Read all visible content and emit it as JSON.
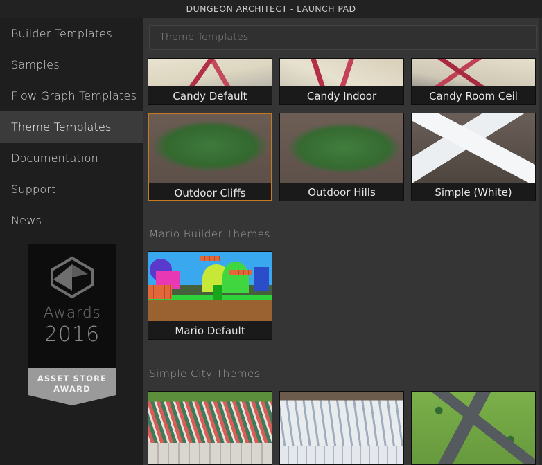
{
  "window": {
    "title": "DUNGEON ARCHITECT - LAUNCH PAD"
  },
  "sidebar": {
    "items": [
      {
        "label": "Builder Templates",
        "selected": false
      },
      {
        "label": "Samples",
        "selected": false
      },
      {
        "label": "Flow Graph Templates",
        "selected": false
      },
      {
        "label": "Theme Templates",
        "selected": true
      },
      {
        "label": "Documentation",
        "selected": false
      },
      {
        "label": "Support",
        "selected": false
      },
      {
        "label": "News",
        "selected": false
      }
    ],
    "award": {
      "word": "Awards",
      "year": "2016",
      "ribbon_line1": "ASSET STORE",
      "ribbon_line2": "AWARD"
    }
  },
  "content": {
    "search_placeholder": "Theme Templates",
    "sections": [
      {
        "header": "",
        "cards": [
          {
            "label": "Candy Default",
            "selected": false
          },
          {
            "label": "Candy Indoor",
            "selected": false
          },
          {
            "label": "Candy Room Ceil",
            "selected": false
          },
          {
            "label": "Outdoor Cliffs",
            "selected": true
          },
          {
            "label": "Outdoor Hills",
            "selected": false
          },
          {
            "label": "Simple (White)",
            "selected": false
          }
        ]
      },
      {
        "header": "Mario Builder Themes",
        "cards": [
          {
            "label": "Mario Default",
            "selected": false
          }
        ]
      },
      {
        "header": "Simple City Themes",
        "cards": [
          {
            "label": "",
            "selected": false
          },
          {
            "label": "",
            "selected": false
          },
          {
            "label": "",
            "selected": false
          }
        ]
      }
    ]
  },
  "colors": {
    "window_bg": "#282828",
    "titlebar_bg": "#222222",
    "sidebar_bg": "#1e1e1e",
    "sidebar_selected_bg": "#3b3b3b",
    "content_bg": "#353535",
    "card_label_bg": "#1a1a1a",
    "selection_accent": "#c87a22",
    "text_primary": "#e8e8e8",
    "text_muted": "#9c9c9c"
  }
}
